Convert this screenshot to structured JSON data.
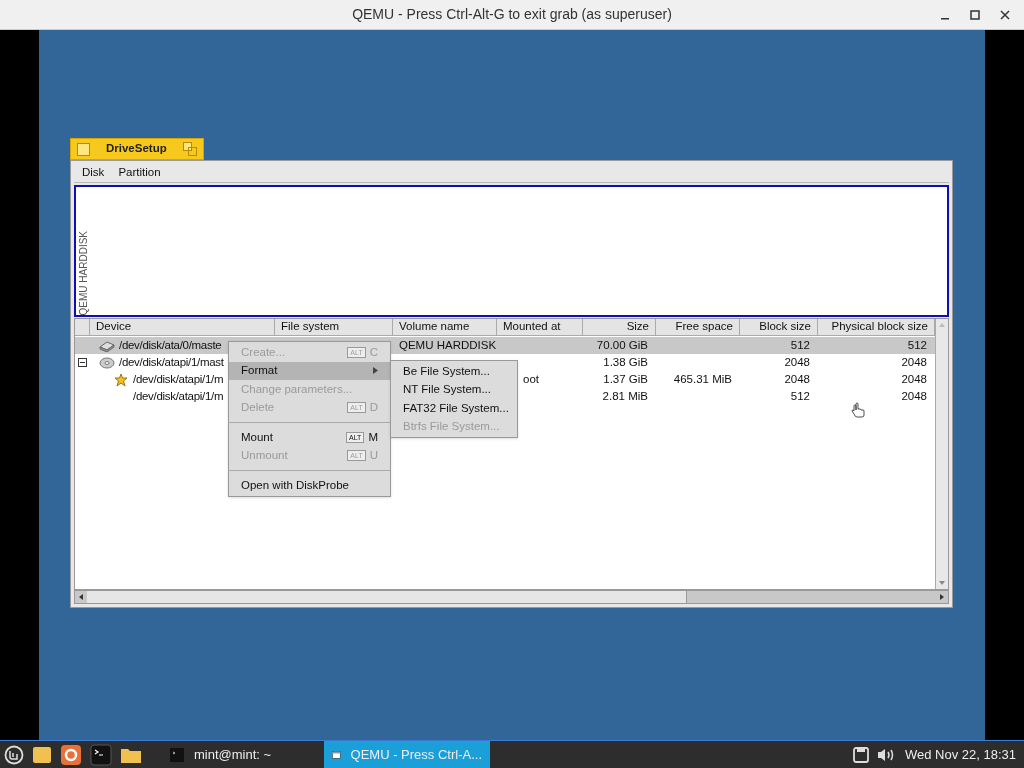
{
  "host_window": {
    "title": "QEMU - Press Ctrl-Alt-G to exit grab (as superuser)"
  },
  "app": {
    "tab_title": "DriveSetup",
    "menu": [
      "Disk",
      "Partition"
    ],
    "disk_map": {
      "label": "QEMU HARDDISK"
    },
    "table": {
      "columns": [
        "Device",
        "File system",
        "Volume name",
        "Mounted at",
        "Size",
        "Free space",
        "Block size",
        "Physical block size"
      ],
      "rows": [
        {
          "kind": "hdd",
          "selected": true,
          "device": "/dev/disk/ata/0/maste",
          "volume_name": "QEMU HARDDISK",
          "size": "70.00 GiB",
          "block_size": "512",
          "physical_block_size": "512"
        },
        {
          "kind": "cd",
          "selected": false,
          "expanded": true,
          "device": "/dev/disk/atapi/1/mast",
          "size": "1.38 GiB",
          "block_size": "2048",
          "physical_block_size": "2048",
          "children": [
            {
              "kind": "boot",
              "selected": false,
              "device": "/dev/disk/atapi/1/m",
              "mounted_at": "oot",
              "size": "1.37 GiB",
              "free_space": "465.31 MiB",
              "block_size": "2048",
              "physical_block_size": "2048"
            },
            {
              "kind": "plain",
              "selected": false,
              "device": "/dev/disk/atapi/1/m",
              "size": "2.81 MiB",
              "block_size": "512",
              "physical_block_size": "2048"
            }
          ]
        }
      ]
    },
    "context_menu": [
      {
        "kind": "item",
        "label": "Create...",
        "disabled": true,
        "selected": false,
        "modifier": "ALT",
        "key": "C"
      },
      {
        "kind": "submenu",
        "label": "Format",
        "disabled": false,
        "selected": true
      },
      {
        "kind": "item",
        "label": "Change parameters...",
        "disabled": true,
        "selected": false
      },
      {
        "kind": "item",
        "label": "Delete",
        "disabled": true,
        "selected": false,
        "modifier": "ALT",
        "key": "D"
      },
      {
        "kind": "separator"
      },
      {
        "kind": "item",
        "label": "Mount",
        "disabled": false,
        "selected": false,
        "modifier": "ALT",
        "key": "M"
      },
      {
        "kind": "item",
        "label": "Unmount",
        "disabled": true,
        "selected": false,
        "modifier": "ALT",
        "key": "U"
      },
      {
        "kind": "separator"
      },
      {
        "kind": "item",
        "label": "Open with DiskProbe",
        "disabled": false,
        "selected": false
      }
    ],
    "submenu": [
      {
        "label": "Be File System...",
        "disabled": false
      },
      {
        "label": "NT File System...",
        "disabled": false
      },
      {
        "label": "FAT32 File System...",
        "disabled": false
      },
      {
        "label": "Btrfs File System...",
        "disabled": true
      }
    ]
  },
  "taskbar": {
    "windows": [
      {
        "label": "mint@mint: ~",
        "selected": false
      },
      {
        "label": "QEMU - Press Ctrl-A...",
        "selected": true
      }
    ],
    "clock": "Wed Nov 22, 18:31"
  }
}
